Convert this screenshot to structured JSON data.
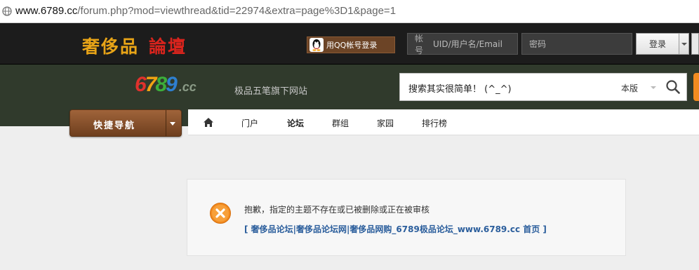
{
  "browser": {
    "url_host": "www.6789.cc",
    "url_path": "/forum.php?mod=viewthread&tid=22974&extra=page%3D1&page=1"
  },
  "header": {
    "logo_part1": "奢侈品",
    "logo_part2": "論壇",
    "qq_login_label": "用QQ帐号登录",
    "account_label": "帐号",
    "account_placeholder": "UID/用户名/Email",
    "password_placeholder": "密码",
    "login_button": "登录"
  },
  "brand": {
    "logo_digits": [
      "6",
      "7",
      "8",
      "9"
    ],
    "logo_suffix": ".cc",
    "tagline": "极品五笔旗下网站"
  },
  "search": {
    "text": "搜索其实很简单！ (^_^)",
    "scope": "本版"
  },
  "nav": {
    "quick_nav_label": "快捷导航",
    "items": [
      {
        "label": "门户",
        "active": false
      },
      {
        "label": "论坛",
        "active": true
      },
      {
        "label": "群组",
        "active": false
      },
      {
        "label": "家园",
        "active": false
      },
      {
        "label": "排行榜",
        "active": false
      }
    ]
  },
  "message": {
    "text": "抱歉，指定的主题不存在或已被删除或正在被审核",
    "link": "[ 奢侈品论坛|奢侈品论坛网|奢侈品网购_6789极品论坛_www.6789.cc 首页 ]"
  },
  "colors": {
    "topbar": "#1c1c1c",
    "midbar": "#303a2c",
    "link": "#2b5e9c",
    "error_icon": "#f28b20"
  }
}
